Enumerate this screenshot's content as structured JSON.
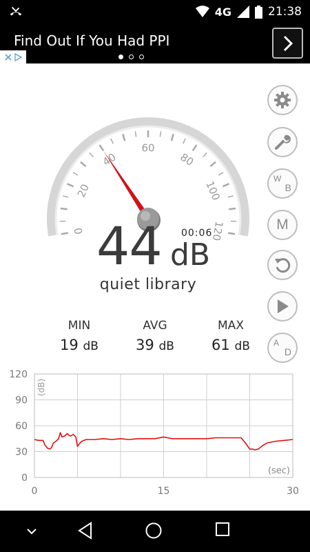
{
  "status_bar": {
    "network": "4G",
    "time": "21:38",
    "icons": [
      "missed-call-icon",
      "wifi-icon",
      "signal-icon",
      "battery-icon"
    ]
  },
  "ad": {
    "text": "Find Out If You Had PPI",
    "pager_total": 3,
    "pager_active": 0,
    "icons": [
      "chevron-right-icon",
      "adchoices-icon"
    ]
  },
  "meter": {
    "value": "44",
    "unit": "dB",
    "timer": "00:06",
    "description": "quiet library",
    "needle_value": 40,
    "gauge_min": 0,
    "gauge_max": 120,
    "gauge_labels": [
      "0",
      "20",
      "40",
      "60",
      "80",
      "100",
      "120"
    ],
    "needle_color": "#d0111b"
  },
  "stats": [
    {
      "label": "MIN",
      "value": "19",
      "unit": "dB"
    },
    {
      "label": "AVG",
      "value": "39",
      "unit": "dB"
    },
    {
      "label": "MAX",
      "value": "61",
      "unit": "dB"
    }
  ],
  "side_buttons": [
    {
      "name": "settings-button",
      "icon": "gear-icon"
    },
    {
      "name": "calibrate-button",
      "icon": "wrench-icon"
    },
    {
      "name": "weighting-button",
      "icon": "wb-icon",
      "top": "W",
      "bottom": "B"
    },
    {
      "name": "memory-button",
      "icon": "m-icon",
      "text": "M"
    },
    {
      "name": "reset-button",
      "icon": "reset-icon"
    },
    {
      "name": "play-button",
      "icon": "play-icon"
    },
    {
      "name": "ad-toggle-button",
      "icon": "ad-icon",
      "top": "A",
      "bottom": "D"
    }
  ],
  "chart_data": {
    "type": "line",
    "ylabel": "(dB)",
    "xlabel": "(sec)",
    "ylim": [
      0,
      120
    ],
    "xlim": [
      0,
      30
    ],
    "yticks": [
      "0",
      "30",
      "60",
      "90",
      "120"
    ],
    "xticks": [
      "0",
      "15",
      "30"
    ],
    "grid": true,
    "line_color": "#e01010",
    "series": [
      {
        "x": [
          0,
          0.5,
          1,
          1.2,
          1.5,
          1.8,
          2.0,
          2.2,
          2.5,
          2.8,
          3.0,
          3.2,
          3.5,
          3.8,
          4.0,
          4.2,
          4.5,
          4.8,
          5.0,
          5.2,
          5.5,
          6.0,
          7,
          8,
          9,
          10,
          11,
          12,
          13,
          14,
          15,
          16,
          17,
          18,
          19,
          20,
          21,
          22,
          23,
          24,
          24.5,
          25.0,
          25.3,
          25.6,
          26.0,
          26.5,
          27,
          28,
          29,
          30
        ],
        "y": [
          44,
          43,
          43,
          38,
          34,
          33,
          35,
          40,
          42,
          45,
          52,
          47,
          48,
          51,
          49,
          48,
          50,
          47,
          36,
          39,
          42,
          44,
          44,
          45,
          44,
          45,
          44,
          45,
          45,
          45,
          47,
          45,
          45,
          45,
          45,
          45,
          46,
          46,
          46,
          46,
          40,
          33,
          33,
          32,
          33,
          37,
          40,
          42,
          43,
          44
        ]
      }
    ]
  }
}
